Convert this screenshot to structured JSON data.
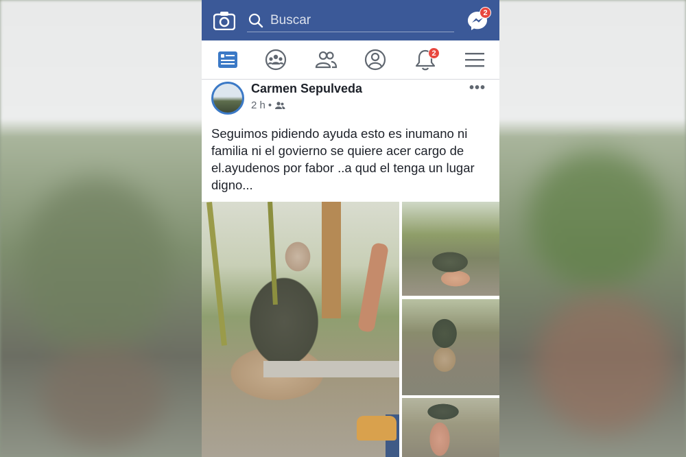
{
  "header": {
    "search_placeholder": "Buscar",
    "messenger_badge": "2",
    "notifications_badge": "2"
  },
  "nav": {
    "items": [
      {
        "name": "news-feed",
        "icon": "news-feed-icon"
      },
      {
        "name": "groups",
        "icon": "groups-icon"
      },
      {
        "name": "friends",
        "icon": "friends-icon"
      },
      {
        "name": "profile",
        "icon": "profile-icon"
      },
      {
        "name": "notifications",
        "icon": "bell-icon"
      },
      {
        "name": "menu",
        "icon": "hamburger-menu-icon"
      }
    ]
  },
  "post": {
    "author": "Carmen Sepulveda",
    "time": "2 h",
    "separator": "•",
    "text": "Seguimos pidiendo ayuda esto es inumano ni familia ni el govierno se quiere acer cargo de el.ayudenos por fabor ..a qud el tenga un lugar digno...",
    "more": "•••"
  },
  "colors": {
    "brand_blue": "#3b5998",
    "badge_red": "#e8473f",
    "text_dark": "#1d2129",
    "text_muted": "#606770"
  }
}
